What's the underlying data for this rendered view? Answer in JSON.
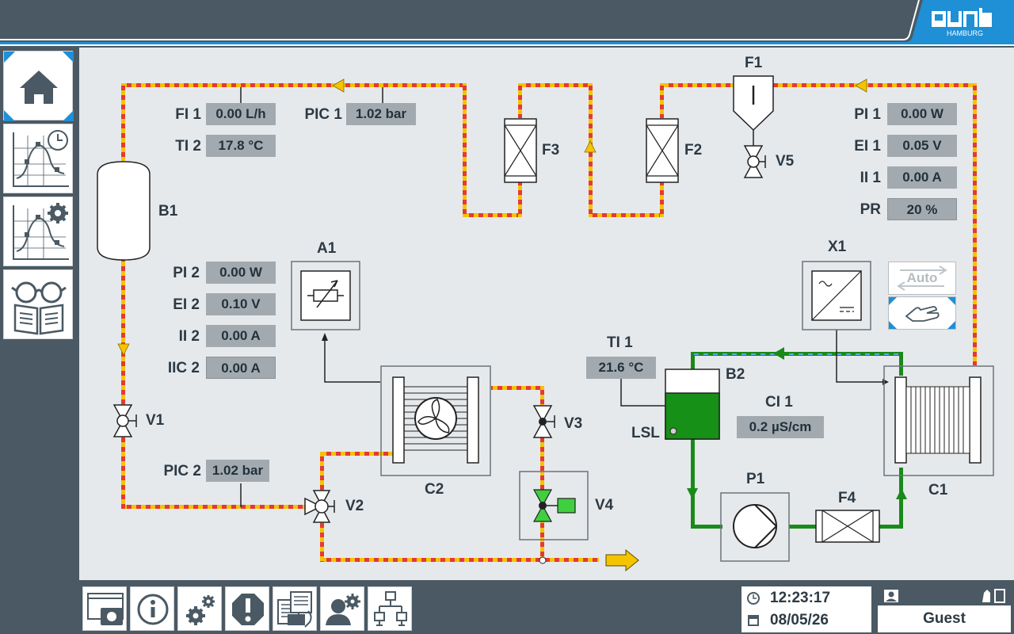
{
  "brand": {
    "logo_text": "gunt",
    "logo_sub": "HAMBURG"
  },
  "colors": {
    "pipe_hot": "#e53935",
    "pipe_stripe": "#f4c400",
    "pipe_green": "#1a8a1a",
    "pipe_blue": "#5aa9e6",
    "accent": "#1f8fd6",
    "tank_fill": "#169016"
  },
  "sidebar": [
    {
      "name": "home",
      "icon": "home-icon"
    },
    {
      "name": "chart-time",
      "icon": "chart-clock-icon"
    },
    {
      "name": "chart-settings",
      "icon": "chart-gear-icon"
    },
    {
      "name": "manual",
      "icon": "glasses-book-icon"
    }
  ],
  "components": {
    "B1": "B1",
    "A1": "A1",
    "C2": "C2",
    "V1": "V1",
    "V2": "V2",
    "V3": "V3",
    "V4": "V4",
    "V5": "V5",
    "F1": "F1",
    "F2": "F2",
    "F3": "F3",
    "F4": "F4",
    "X1": "X1",
    "B2": "B2",
    "C1": "C1",
    "P1": "P1",
    "LSL": "LSL"
  },
  "readings": {
    "FI1": {
      "label": "FI 1",
      "value": "0.00 L/h"
    },
    "TI2": {
      "label": "TI 2",
      "value": "17.8 °C"
    },
    "PIC1": {
      "label": "PIC 1",
      "value": "1.02 bar"
    },
    "PI2": {
      "label": "PI 2",
      "value": "0.00 W"
    },
    "EI2": {
      "label": "EI 2",
      "value": "0.10 V"
    },
    "II2": {
      "label": "II 2",
      "value": "0.00 A"
    },
    "IIC2": {
      "label": "IIC 2",
      "value": "0.00 A"
    },
    "PIC2": {
      "label": "PIC 2",
      "value": "1.02 bar"
    },
    "PI1": {
      "label": "PI 1",
      "value": "0.00 W"
    },
    "EI1": {
      "label": "EI 1",
      "value": "0.05 V"
    },
    "II1": {
      "label": "II 1",
      "value": "0.00 A"
    },
    "PR": {
      "label": "PR",
      "value": "20 %"
    },
    "TI1": {
      "label": "TI 1",
      "value": "21.6 °C"
    },
    "CI1": {
      "label": "CI 1",
      "value": "0.2 µS/cm"
    }
  },
  "mode": {
    "auto_label": "Auto",
    "manual_icon": "hand-icon"
  },
  "bottombar": [
    {
      "name": "screenshot",
      "icon": "camera-icon"
    },
    {
      "name": "info",
      "icon": "info-icon"
    },
    {
      "name": "settings",
      "icon": "gears-icon"
    },
    {
      "name": "alarms",
      "icon": "alarm-icon"
    },
    {
      "name": "data-export",
      "icon": "printer-icon"
    },
    {
      "name": "user-settings",
      "icon": "user-gear-icon"
    },
    {
      "name": "network",
      "icon": "network-icon"
    }
  ],
  "status": {
    "time": "12:23:17",
    "date": "08/05/26",
    "user": "Guest"
  }
}
